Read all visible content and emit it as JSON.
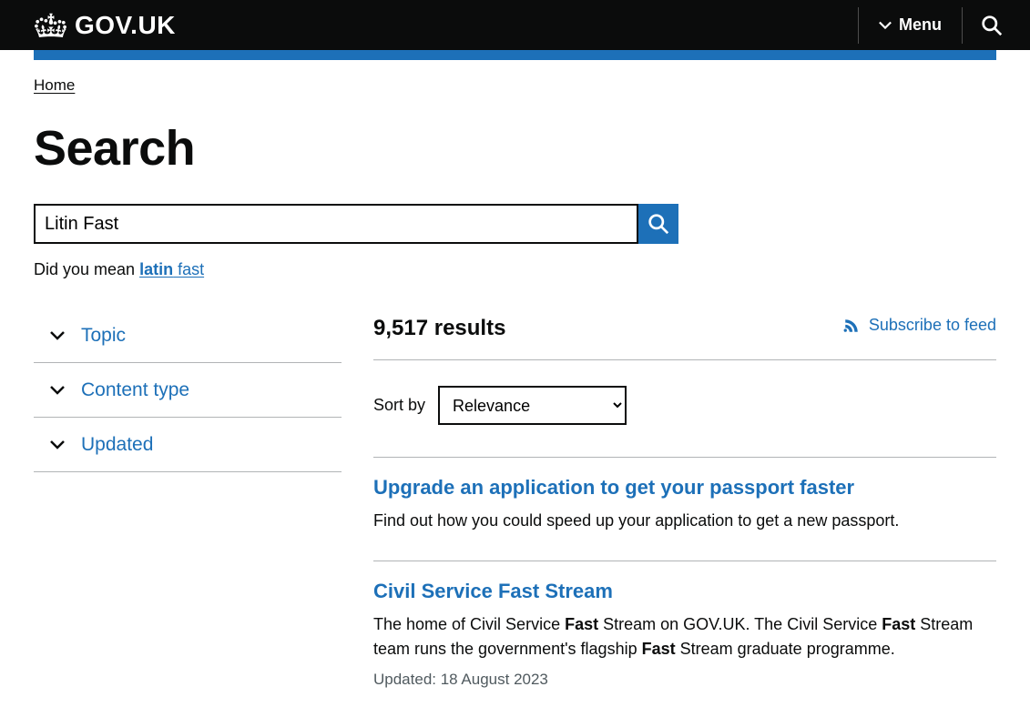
{
  "header": {
    "logo_text": "GOV.UK",
    "menu_label": "Menu"
  },
  "breadcrumb": {
    "home": "Home"
  },
  "page": {
    "title": "Search"
  },
  "search": {
    "value": "Litin Fast",
    "did_you_mean_prefix": "Did you mean ",
    "suggestion_bold": "latin",
    "suggestion_rest": " fast"
  },
  "filters": [
    {
      "label": "Topic"
    },
    {
      "label": "Content type"
    },
    {
      "label": "Updated"
    }
  ],
  "results": {
    "count_text": "9,517 results",
    "subscribe_label": "Subscribe to feed",
    "sort_label": "Sort by",
    "sort_value": "Relevance"
  },
  "items": [
    {
      "title": "Upgrade an application to get your passport faster",
      "desc_html": "Find out how you could speed up your application to get a new passport.",
      "updated": ""
    },
    {
      "title": "Civil Service Fast Stream",
      "desc_html": "The home of Civil Service <b>Fast</b> Stream on GOV.UK. The Civil Service <b>Fast</b> Stream team runs the government's flagship <b>Fast</b> Stream graduate programme.",
      "updated": "Updated: 18 August 2023"
    }
  ]
}
